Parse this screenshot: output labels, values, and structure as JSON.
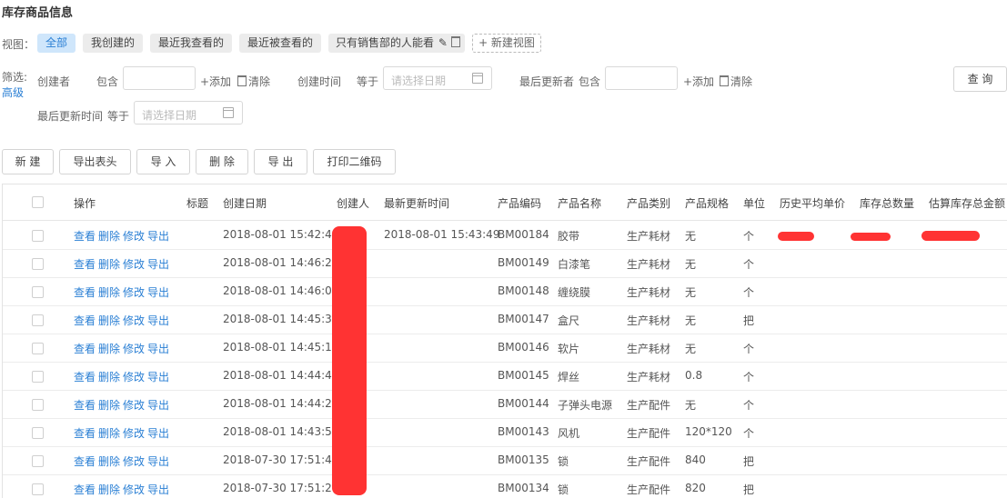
{
  "page": {
    "title": "库存商品信息"
  },
  "views": {
    "label": "视图：",
    "chips": [
      {
        "label": "全部",
        "active": true
      },
      {
        "label": "我创建的"
      },
      {
        "label": "最近我查看的"
      },
      {
        "label": "最近被查看的"
      },
      {
        "label": "只有销售部的人能看"
      }
    ],
    "new_view": "+ 新建视图"
  },
  "filter": {
    "label": "筛选:",
    "advanced": "高级",
    "creator_label": "创建者",
    "contains": "包含",
    "add": "+添加",
    "clear": "清除",
    "created_time_label": "创建时间",
    "equals": "等于",
    "date_placeholder": "请选择日期",
    "last_updater_label": "最后更新者",
    "last_updated_time_label": "最后更新时间",
    "query": "查 询"
  },
  "toolbar": [
    "新 建",
    "导出表头",
    "导 入",
    "删 除",
    "导 出",
    "打印二维码"
  ],
  "table": {
    "headers": [
      "操作",
      "标题",
      "创建日期",
      "创建人",
      "最新更新时间",
      "产品编码",
      "产品名称",
      "产品类别",
      "产品规格",
      "单位",
      "历史平均单价",
      "库存总数量",
      "估算库存总金额"
    ],
    "ops": [
      "查看",
      "删除",
      "修改",
      "导出"
    ],
    "rows": [
      {
        "created": "2018-08-01 15:42:48",
        "updated": "2018-08-01 15:43:49",
        "code": "BM00184",
        "name": "胶带",
        "cat": "生产耗材",
        "spec": "无",
        "unit": "个"
      },
      {
        "created": "2018-08-01 14:46:28",
        "updated": "",
        "code": "BM00149",
        "name": "白漆笔",
        "cat": "生产耗材",
        "spec": "无",
        "unit": "个"
      },
      {
        "created": "2018-08-01 14:46:03",
        "updated": "",
        "code": "BM00148",
        "name": "缠绕膜",
        "cat": "生产耗材",
        "spec": "无",
        "unit": "个"
      },
      {
        "created": "2018-08-01 14:45:32",
        "updated": "",
        "code": "BM00147",
        "name": "盒尺",
        "cat": "生产耗材",
        "spec": "无",
        "unit": "把"
      },
      {
        "created": "2018-08-01 14:45:12",
        "updated": "",
        "code": "BM00146",
        "name": "软片",
        "cat": "生产耗材",
        "spec": "无",
        "unit": "个"
      },
      {
        "created": "2018-08-01 14:44:48",
        "updated": "",
        "code": "BM00145",
        "name": "焊丝",
        "cat": "生产耗材",
        "spec": "0.8",
        "unit": "个"
      },
      {
        "created": "2018-08-01 14:44:23",
        "updated": "",
        "code": "BM00144",
        "name": "子弹头电源",
        "cat": "生产配件",
        "spec": "无",
        "unit": "个"
      },
      {
        "created": "2018-08-01 14:43:54",
        "updated": "",
        "code": "BM00143",
        "name": "风机",
        "cat": "生产配件",
        "spec": "120*120",
        "unit": "个"
      },
      {
        "created": "2018-07-30 17:51:41",
        "updated": "",
        "code": "BM00135",
        "name": "锁",
        "cat": "生产配件",
        "spec": "840",
        "unit": "把"
      },
      {
        "created": "2018-07-30 17:51:24",
        "updated": "",
        "code": "BM00134",
        "name": "锁",
        "cat": "生产配件",
        "spec": "820",
        "unit": "把"
      }
    ]
  },
  "colors": {
    "accent": "#2a7fd4",
    "active_chip_bg": "#cfe6fb",
    "redaction": "#ff3333"
  }
}
